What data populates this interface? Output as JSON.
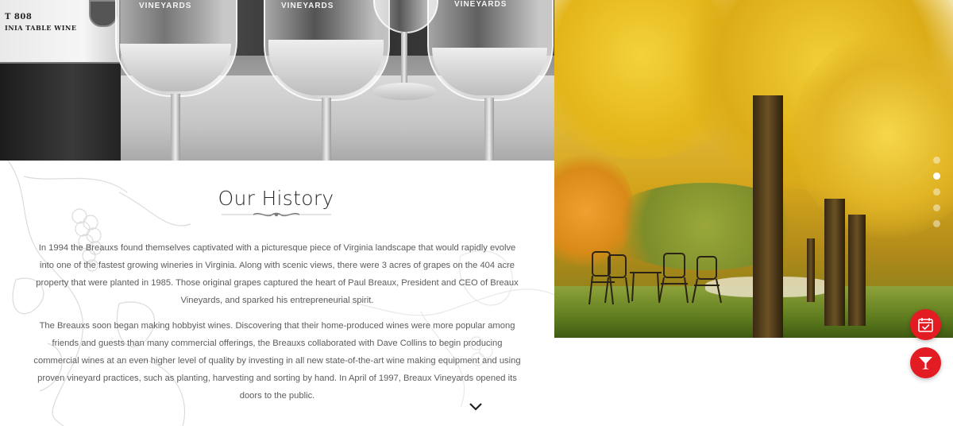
{
  "glasses_photo": {
    "bottle_label_lines": [
      "T 808",
      "INIA TABLE WINE"
    ],
    "glass_etching": [
      "VINEYARDS",
      "VINEYARDS",
      "VINEYARDS"
    ]
  },
  "history": {
    "title": "Our History",
    "paragraphs": [
      "In 1994 the Breauxs found themselves captivated with a picturesque piece of Virginia landscape that would rapidly evolve into one of the fastest growing wineries in Virginia. Along with scenic views, there were 3 acres of grapes on the 404 acre property that were planted in 1985. Those original grapes captured the heart of Paul Breaux, President and CEO of Breaux Vineyards, and sparked his entrepreneurial spirit.",
      "The Breauxs soon began making hobbyist wines. Discovering that their home-produced wines were more popular among friends and guests than many commercial offerings, the Breauxs collaborated with Dave Collins to begin producing commercial wines at an even higher level of quality by investing in all new state-of-the-art wine making equipment and using proven vineyard practices, such as planting, harvesting and sorting by hand. In April of 1997, Breaux Vineyards opened its doors to the public."
    ],
    "scroll_icon": "chevron-down-icon"
  },
  "carousel": {
    "slide_count": 5,
    "active_index": 1
  },
  "actions": {
    "reservations_icon": "calendar-check-icon",
    "tasting_icon": "cocktail-glass-icon",
    "accent_color": "#e31b23"
  }
}
